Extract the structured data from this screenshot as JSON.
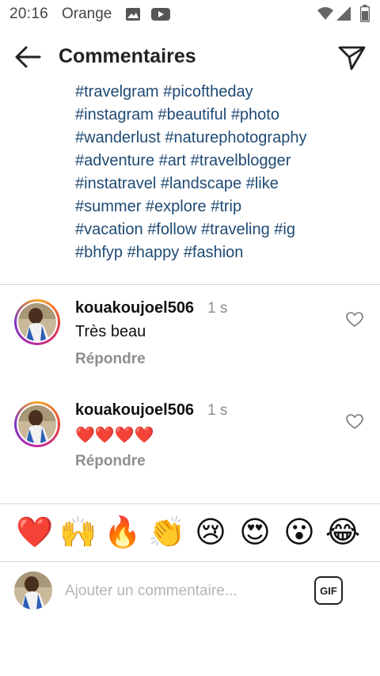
{
  "status_bar": {
    "time": "20:16",
    "carrier": "Orange",
    "icons": [
      "image-icon",
      "youtube-icon",
      "wifi-icon",
      "signal-icon",
      "battery-icon"
    ]
  },
  "app_bar": {
    "title": "Commentaires",
    "back_icon": "arrow-left-icon",
    "send_icon": "paper-plane-icon"
  },
  "caption_hashtags": [
    [
      "#travelgram",
      "#picoftheday"
    ],
    [
      "#instagram",
      "#beautiful",
      "#photo"
    ],
    [
      "#wanderlust",
      "#naturephotography"
    ],
    [
      "#adventure",
      "#art",
      "#travelblogger"
    ],
    [
      "#instatravel",
      "#landscape",
      "#like"
    ],
    [
      "#summer",
      "#explore",
      "#trip"
    ],
    [
      "#vacation",
      "#follow",
      "#traveling",
      "#ig"
    ],
    [
      "#bhfyp",
      "#happy",
      "#fashion"
    ]
  ],
  "comments": [
    {
      "username": "kouakoujoel506",
      "time": "1 s",
      "text": "Très beau",
      "reply_label": "Répondre"
    },
    {
      "username": "kouakoujoel506",
      "time": "1 s",
      "text": "❤️❤️❤️❤️",
      "reply_label": "Répondre"
    }
  ],
  "emoji_reactions": [
    "❤️",
    "🙌",
    "🔥",
    "👏",
    "😢",
    "😍",
    "😮",
    "😂"
  ],
  "composer": {
    "placeholder": "Ajouter un commentaire...",
    "gif_label": "GIF"
  },
  "colors": {
    "hashtag": "#1f4a73",
    "muted": "#8e8e8e",
    "divider": "#d8d8d8"
  }
}
